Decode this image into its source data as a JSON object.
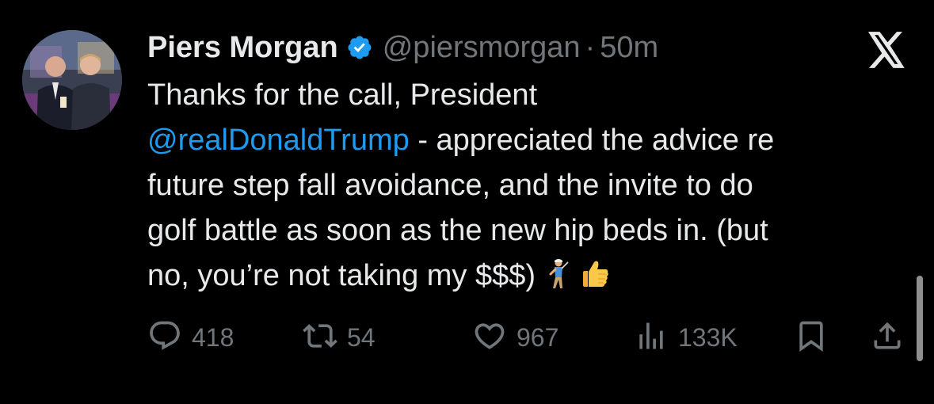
{
  "tweet": {
    "author_name": "Piers Morgan",
    "handle": "@piersmorgan",
    "separator": "·",
    "time": "50m",
    "text_lines": [
      "Thanks for the call, President",
      "- appreciated the advice re",
      "future step fall avoidance, and the invite to do",
      "golf battle as soon as the new hip beds in. (but",
      "no, you’re not taking my $$$)"
    ],
    "mention": "@realDonaldTrump",
    "emojis": [
      "golfer",
      "thumbs-up"
    ]
  },
  "actions": {
    "replies": "418",
    "reposts": "54",
    "likes": "967",
    "views": "133K"
  },
  "colors": {
    "background": "#000000",
    "text": "#e7e9ea",
    "secondary": "#71767b",
    "link": "#1d9bf0",
    "verified": "#1d9bf0"
  },
  "icons": [
    "x-logo-icon",
    "verified-badge-icon",
    "reply-icon",
    "repost-icon",
    "like-icon",
    "views-icon",
    "bookmark-icon",
    "share-icon"
  ]
}
